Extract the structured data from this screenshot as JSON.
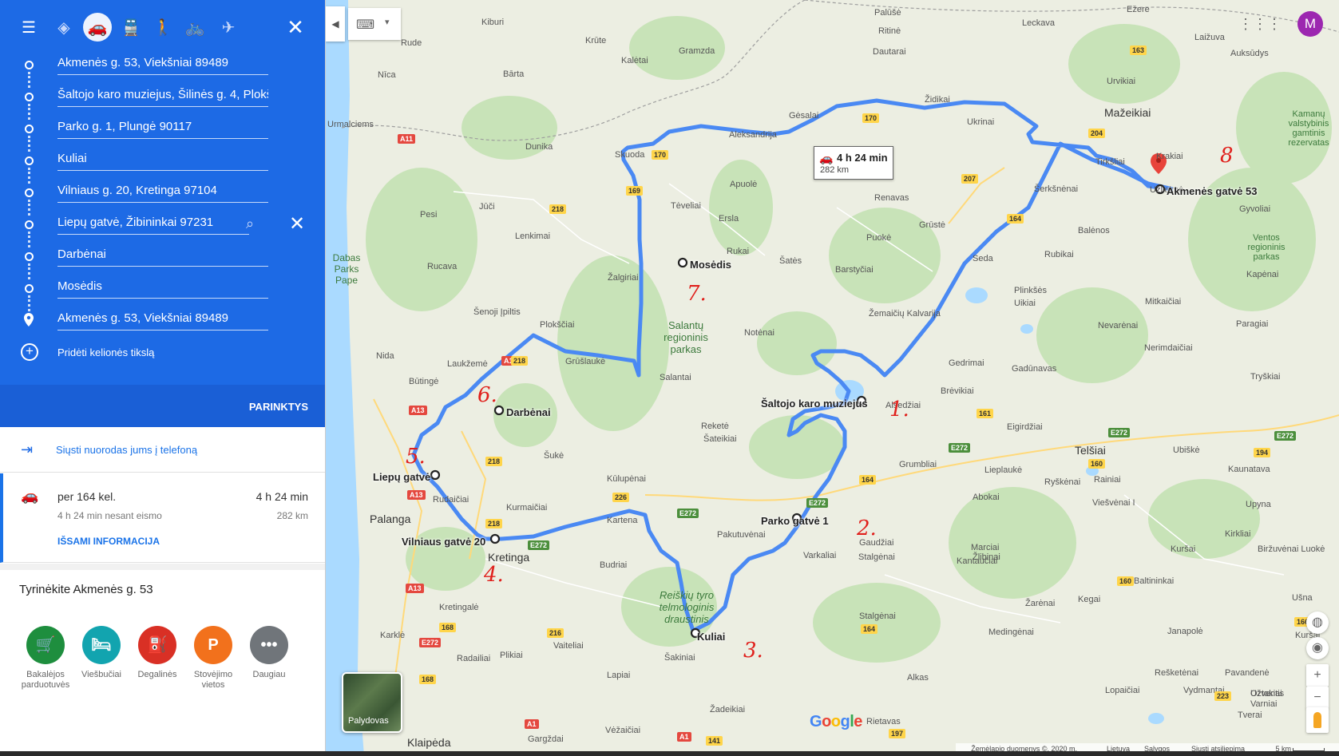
{
  "panel": {
    "travel_modes": [
      "directions-icon",
      "car-icon",
      "transit-icon",
      "walk-icon",
      "bike-icon",
      "flight-icon"
    ],
    "stops": [
      "Akmenės g. 53, Viekšniai 89489",
      "Šaltojo karo muziejus, Šilinės g. 4, Plokščiai",
      "Parko g. 1, Plungė 90117",
      "Kuliai",
      "Vilniaus g. 20, Kretinga 97104",
      "Liepų gatvė, Žibininkai 97231",
      "Darbėnai",
      "Mosėdis",
      "Akmenės g. 53, Viekšniai 89489"
    ],
    "add_destination": "Pridėti kelionės tikslą",
    "options": "PARINKTYS",
    "send_to_phone": "Siųsti nuorodas jums į telefoną",
    "route": {
      "via": "per 164 kel.",
      "time": "4 h 24 min",
      "sub": "4 h 24 min nesant eismo",
      "distance": "282 km",
      "details": "IŠSAMI INFORMACIJA"
    },
    "explore": {
      "title": "Tyrinėkite Akmenės g. 53",
      "categories": [
        {
          "label": "Bakalėjos parduotuvės",
          "color": "#1e8e3e",
          "icon": "cart-icon"
        },
        {
          "label": "Viešbučiai",
          "color": "#12a4af",
          "icon": "bed-icon"
        },
        {
          "label": "Degalinės",
          "color": "#d93025",
          "icon": "fuel-icon"
        },
        {
          "label": "Stovėjimo vietos",
          "color": "#f2711c",
          "icon": "parking-icon"
        },
        {
          "label": "Daugiau",
          "color": "#70757a",
          "icon": "more-icon"
        }
      ]
    }
  },
  "map": {
    "info": {
      "time": "4 h 24 min",
      "distance": "282 km"
    },
    "waypoints": [
      {
        "label": "Šaltojo karo muziejus",
        "num": "1."
      },
      {
        "label": "Parko gatvė 1",
        "num": "2."
      },
      {
        "label": "Kuliai",
        "num": "3."
      },
      {
        "label": "Vilniaus gatvė 20",
        "num": "4."
      },
      {
        "label": "Liepų gatvė",
        "num": "5."
      },
      {
        "label": "Darbėnai",
        "num": "6."
      },
      {
        "label": "Mosėdis",
        "num": "7."
      },
      {
        "label": "Akmenės gatvė 53",
        "num": "8"
      }
    ],
    "places": [
      "Kiburi",
      "Krūte",
      "Kalėtai",
      "Gramzda",
      "Bārta",
      "Nīca",
      "Dunika",
      "Skuoda",
      "Aleksandrija",
      "Gėsalai",
      "Židikai",
      "Ukrinai",
      "Mažeikiai",
      "Tirkšliai",
      "Krakiai",
      "Užlieknė",
      "Gyvoliai",
      "Šerkšnėnai",
      "Renavas",
      "Grūstė",
      "Seda",
      "Balėnos",
      "Rubikai",
      "Kapėnai",
      "Apuolė",
      "Tėveliai",
      "Ersla",
      "Rukai",
      "Šatės",
      "Barstyčiai",
      "Puokė",
      "Jūči",
      "Pesi",
      "Lenkimai",
      "Rucava",
      "Žalgiriai",
      "Šenoji Įpiltis",
      "Plokščiai",
      "Notėnai",
      "Nida",
      "Laukžemė",
      "Grūšlaukė",
      "Salantai",
      "Būtingė",
      "Reketė",
      "Šateikiai",
      "Šukė",
      "Kūlupėnai",
      "Rudaičiai",
      "Kurmaičiai",
      "Palanga",
      "Kartena",
      "Pakutuvėnai",
      "Varkaliai",
      "Gaudžiai",
      "Kretinga",
      "Budriai",
      "Kretingalė",
      "Karklė",
      "Vaiteliai",
      "Radailiai",
      "Plikiai",
      "Lapiai",
      "Šakiniai",
      "Žadeikiai",
      "Stalgėnai",
      "Žlibinai",
      "Alkas",
      "Rietavas",
      "Gargždai",
      "Vėžaičiai",
      "Klaipėda",
      "Medingėnai",
      "Telšiai",
      "Lieplaukė",
      "Abokai",
      "Grumbliai",
      "Gedrimai",
      "Brėvikiai",
      "Alsedžiai",
      "Eigirdžiai",
      "Gadūnavas",
      "Plinkšės",
      "Uikiai",
      "Žemaičių Kalvarija",
      "Nevarėnai",
      "Mitkaičiai",
      "Nerimdaičiai",
      "Paragiai",
      "Tryškiai",
      "Ubiškė",
      "Kaunatava",
      "Rainiai",
      "Ryškėnai",
      "Viešvėnai I",
      "Upyna",
      "Kirkliai",
      "Marciai",
      "Kantaučiai",
      "Baltininkai",
      "Kuršai",
      "Biržuvėnai Luokė",
      "Kegai",
      "Žarėnai",
      "Janapolė",
      "Ušna",
      "Kuršai",
      "Rešketėnai",
      "Pavandenė",
      "Lopaičiai",
      "Vydmantai",
      "Tverai",
      "Varniai",
      "Užventis",
      "Ožtakiai",
      "Palūšė",
      "Ritinė",
      "Dautarai",
      "Leckava",
      "Ežere",
      "Laižuva",
      "Auksūdys",
      "Urvikiai",
      "Kamanų valstybinis gamtinis rezervatas",
      "Ventos regioninis parkas",
      "Salantų regioninis parkas",
      "Reiškių tyro telmologinis draustinis",
      "Dabas Parks Pape",
      "Rude",
      "Urmalciems"
    ],
    "footer": {
      "data": "Žemėlapio duomenys ©, 2020 m.",
      "country": "Lietuva",
      "terms": "Sąlygos",
      "feedback": "Siųsti atsiliepimą",
      "scale": "5 km"
    },
    "satellite_label": "Palydovas",
    "avatar_letter": "M"
  },
  "colors": {
    "panel_blue": "#1d6ae5",
    "route_blue": "#4a89f3",
    "annotation_red": "#e0201c"
  }
}
